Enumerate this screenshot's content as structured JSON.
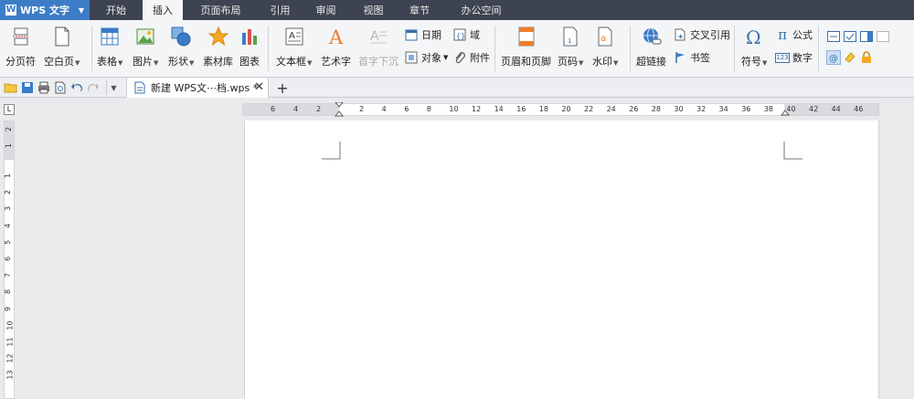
{
  "app": {
    "name": "WPS 文字"
  },
  "menu": {
    "tabs": [
      {
        "label": "开始"
      },
      {
        "label": "插入"
      },
      {
        "label": "页面布局"
      },
      {
        "label": "引用"
      },
      {
        "label": "审阅"
      },
      {
        "label": "视图"
      },
      {
        "label": "章节"
      },
      {
        "label": "办公空间"
      }
    ],
    "active_index": 1
  },
  "ribbon": {
    "page_break": "分页符",
    "blank_page": "空白页",
    "table": "表格",
    "picture": "图片",
    "shape": "形状",
    "material": "素材库",
    "chart": "图表",
    "textbox": "文本框",
    "wordart": "艺术字",
    "dropcap": "首字下沉",
    "date": "日期",
    "field": "域",
    "object": "对象",
    "attachment": "附件",
    "header_footer": "页眉和页脚",
    "page_number": "页码",
    "watermark": "水印",
    "hyperlink": "超链接",
    "cross_ref": "交叉引用",
    "bookmark": "书签",
    "symbol": "符号",
    "formula": "公式",
    "number": "数字",
    "number_icon": "123"
  },
  "document": {
    "tab_title": "新建 WPS文⋯档.wps *"
  },
  "ruler": {
    "corner": "L",
    "h_left": [
      "6",
      "4",
      "2"
    ],
    "h_right": [
      "2",
      "4",
      "6",
      "8",
      "10",
      "12",
      "14",
      "16",
      "18",
      "20",
      "22",
      "24",
      "26",
      "28",
      "30",
      "32",
      "34",
      "36",
      "38",
      "40",
      "42",
      "44",
      "46"
    ],
    "v_top": [
      "2",
      "1"
    ],
    "v_body": [
      "1",
      "2",
      "3",
      "4",
      "5",
      "6",
      "7",
      "8",
      "9",
      "10",
      "11",
      "12",
      "13"
    ]
  },
  "colors": {
    "menubar": "#3d4350",
    "app_button": "#3d7dc8",
    "ribbon": "#f4f5f7"
  }
}
